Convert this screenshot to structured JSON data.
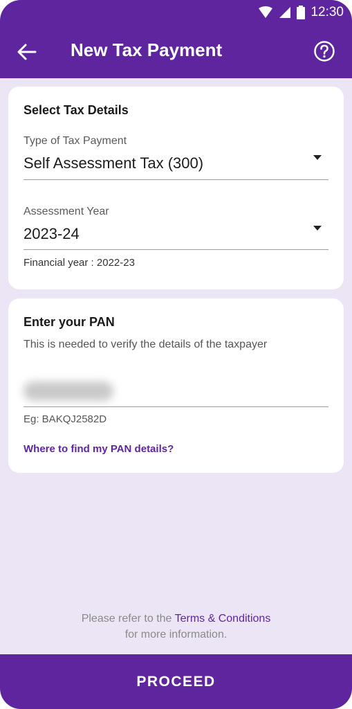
{
  "status_bar": {
    "time": "12:30",
    "icons": [
      "wifi-icon",
      "signal-icon",
      "battery-icon"
    ]
  },
  "app_bar": {
    "title": "New Tax Payment",
    "back_icon": "arrow-left-icon",
    "help_icon": "help-circle-icon"
  },
  "tax_details": {
    "heading": "Select Tax Details",
    "type_label": "Type of Tax Payment",
    "type_value": "Self Assessment Tax (300)",
    "year_label": "Assessment Year",
    "year_value": "2023-24",
    "financial_year": "Financial year : 2022-23"
  },
  "pan": {
    "heading": "Enter your PAN",
    "description": "This is needed to verify the details of the taxpayer",
    "example": "Eg: BAKQJ2582D",
    "help_link": "Where to find my PAN details?"
  },
  "footer": {
    "terms_prefix": "Please refer to the ",
    "terms_link": "Terms & Conditions",
    "terms_suffix": " for more information.",
    "proceed_label": "PROCEED"
  },
  "colors": {
    "brand": "#5f259f",
    "background": "#ece5f6"
  }
}
